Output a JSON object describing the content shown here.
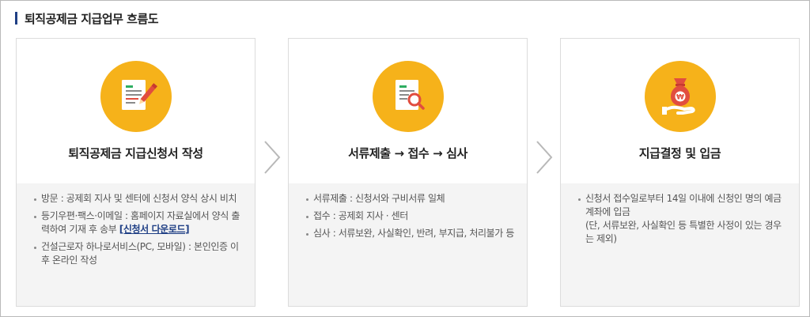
{
  "heading": {
    "title": "퇴직공제금 지급업무 흐름도"
  },
  "steps": [
    {
      "title": "퇴직공제금 지급신청서 작성",
      "icon": "document-pen-icon",
      "items": [
        {
          "text": "방문 : 공제회 지사 및 센터에 신청서 양식 상시 비치"
        },
        {
          "text": "등기우편·팩스·이메일 : 홈페이지 자료실에서 양식 출력하여 기재 후 송부",
          "link": "[신청서 다운로드]"
        },
        {
          "text": "건설근로자 하나로서비스(PC, 모바일) : 본인인증 이후 온라인 작성"
        }
      ]
    },
    {
      "title": "서류제출 → 접수 → 심사",
      "icon": "document-search-icon",
      "items": [
        {
          "text": "서류제출 : 신청서와 구비서류 일체"
        },
        {
          "text": "접수 : 공제회 지사 · 센터"
        },
        {
          "text": "심사 : 서류보완, 사실확인, 반려, 부지급, 처리불가 등"
        }
      ]
    },
    {
      "title": "지급결정 및 입금",
      "icon": "money-bag-hand-icon",
      "items": [
        {
          "text": "신청서 접수일로부터 14일 이내에 신청인 명의 예금계좌에 입금"
        },
        {
          "text": "(단, 서류보완, 사실확인 등 특별한 사정이 있는 경우는 제외)"
        }
      ]
    }
  ],
  "colors": {
    "accent": "#f6b21a",
    "heading_bar": "#1f3f85",
    "link": "#1f3f85",
    "panel": "#f4f4f4"
  }
}
